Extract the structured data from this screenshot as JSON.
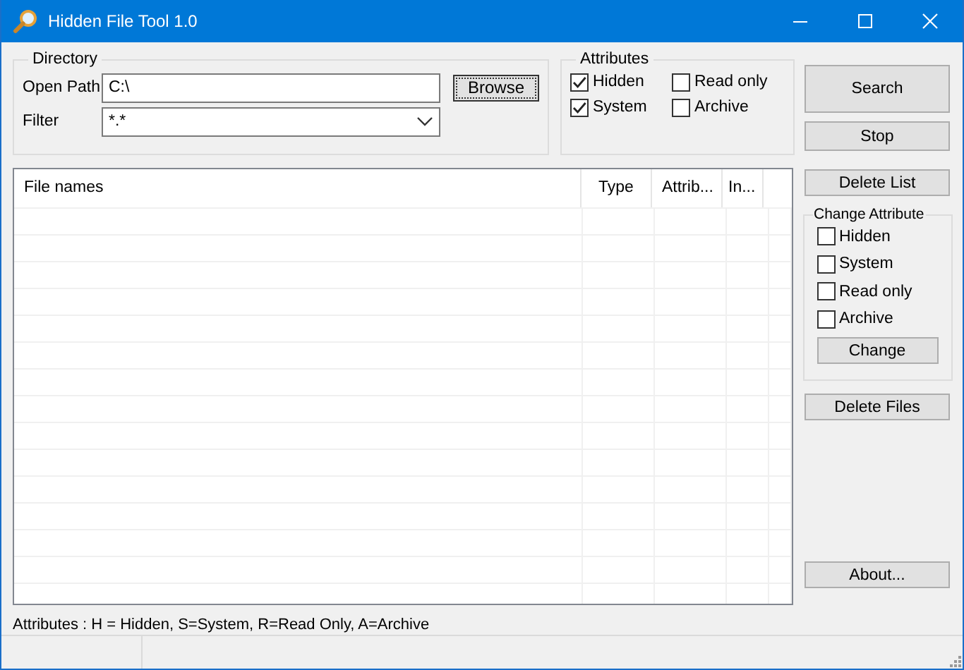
{
  "window": {
    "title": "Hidden File Tool 1.0"
  },
  "directory": {
    "title": "Directory",
    "path_label": "Open Path",
    "path_value": "C:\\",
    "browse_button": "Browse",
    "filter_label": "Filter",
    "filter_value": "*.*"
  },
  "attributes": {
    "title": "Attributes",
    "options": [
      {
        "label": "Hidden",
        "checked": true
      },
      {
        "label": "Read only",
        "checked": false
      },
      {
        "label": "System",
        "checked": true
      },
      {
        "label": "Archive",
        "checked": false
      }
    ]
  },
  "actions": {
    "search": "Search",
    "stop": "Stop",
    "delete_list": "Delete List",
    "delete_files": "Delete Files",
    "about": "About..."
  },
  "table": {
    "columns": [
      "File names",
      "Type",
      "Attrib...",
      "In..."
    ]
  },
  "change_attribute": {
    "title": "Change Attribute",
    "options": [
      {
        "label": "Hidden",
        "checked": false
      },
      {
        "label": "System",
        "checked": false
      },
      {
        "label": "Read only",
        "checked": false
      },
      {
        "label": "Archive",
        "checked": false
      }
    ],
    "button": "Change"
  },
  "legend_text": "Attributes : H = Hidden, S=System, R=Read Only, A=Archive"
}
